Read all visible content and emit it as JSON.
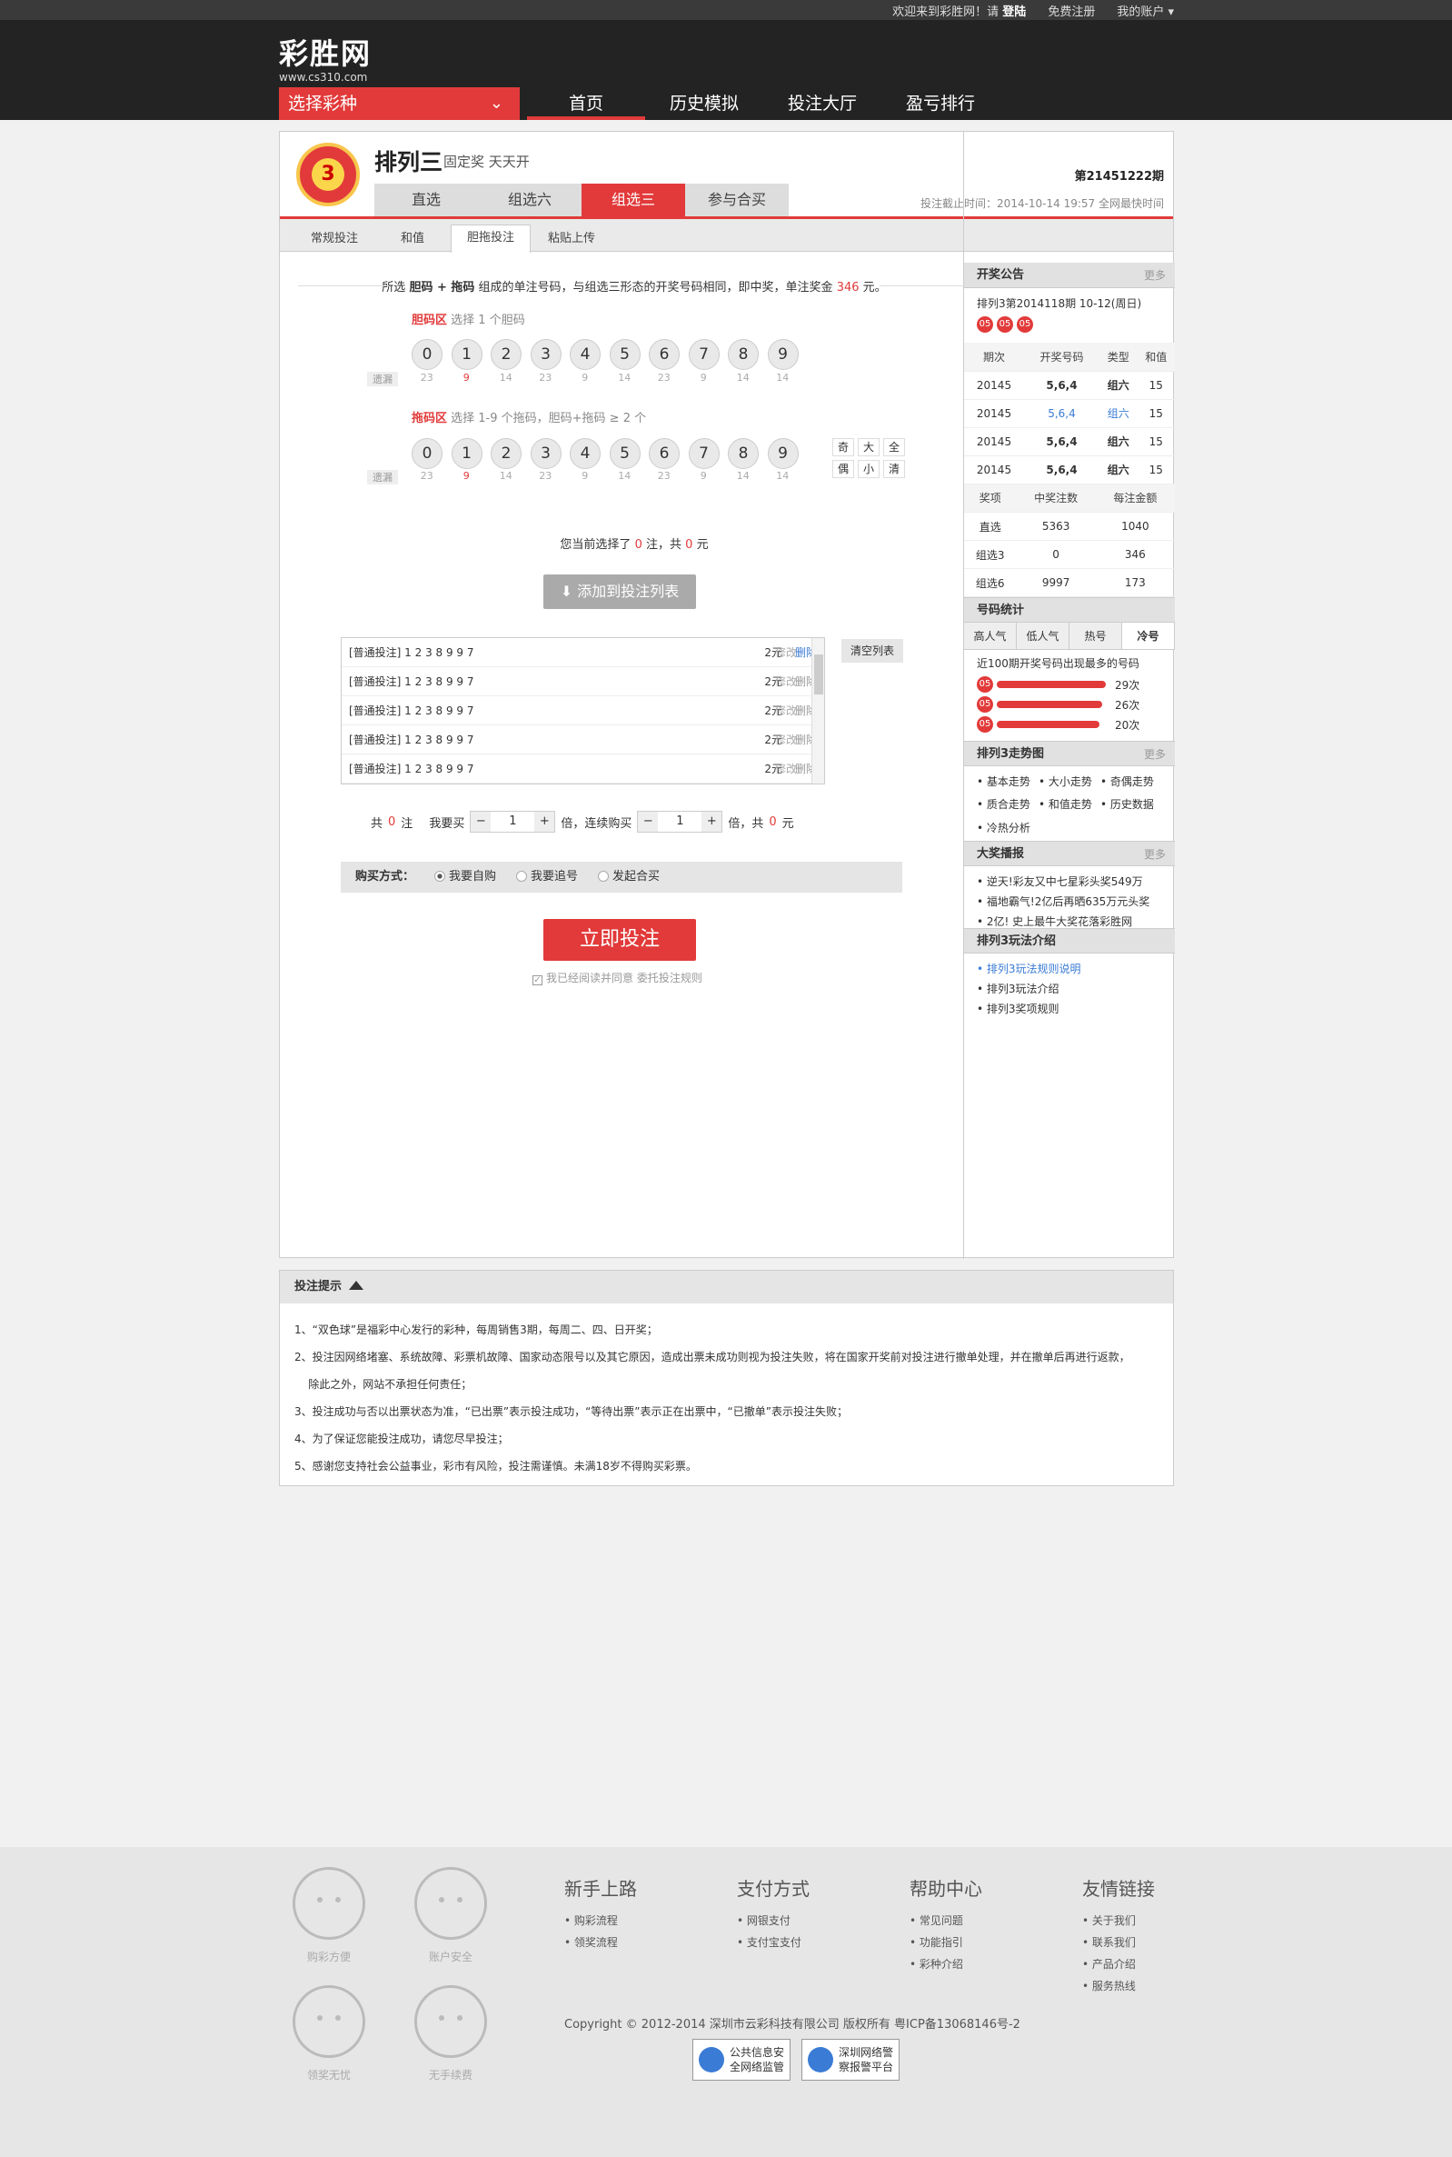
{
  "topbar": {
    "welcome": "欢迎来到彩胜网！请",
    "login": "登陆",
    "register": "免费注册",
    "account": "我的账户 ▾"
  },
  "logo": {
    "name": "彩胜网",
    "url": "www.cs310.com"
  },
  "select_lottery": "选择彩种",
  "nav": [
    "首页",
    "历史模拟",
    "投注大厅",
    "盈亏排行"
  ],
  "product": {
    "badge_text": "3",
    "name": "排列三",
    "sub": "固定奖 天天开",
    "issue": "第21451222期",
    "deadline": "投注截止时间：2014-10-14 19:57 全网最快时间",
    "tabs": [
      "直选",
      "组选六",
      "组选三",
      "参与合买"
    ],
    "subtabs": [
      "常规投注",
      "和值",
      "胆拖投注",
      "粘贴上传"
    ]
  },
  "rule": {
    "pre": "所选",
    "bold": "胆码 + 拖码",
    "mid": "组成的单注号码，与组选三形态的开奖号码相同，即中奖，单注奖金",
    "prize": "346",
    "post": "元。"
  },
  "zones": {
    "dan_label": "胆码区",
    "dan_hint": "选择 1 个胆码",
    "tuo_label": "拖码区",
    "tuo_hint": "选择 1-9 个拖码，胆码+拖码 ≥ 2 个",
    "miss_label": "遗漏",
    "balls": [
      "0",
      "1",
      "2",
      "3",
      "4",
      "5",
      "6",
      "7",
      "8",
      "9"
    ],
    "miss": [
      "23",
      "9",
      "14",
      "23",
      "9",
      "14",
      "23",
      "9",
      "14",
      "14"
    ],
    "quick": [
      "奇",
      "大",
      "全",
      "偶",
      "小",
      "清"
    ]
  },
  "summary": {
    "pre": "您当前选择了",
    "count": "0",
    "mid": "注，共",
    "amount": "0",
    "post": "元"
  },
  "add_button": "⬇ 添加到投注列表",
  "betlist": [
    {
      "label": "[普通投注]  1 2 3 8 9 9 7",
      "amount": "2元",
      "edit": "修改",
      "del": "删除"
    },
    {
      "label": "[普通投注]  1 2 3 8 9 9 7",
      "amount": "2元",
      "edit": "修改",
      "del": "删除"
    },
    {
      "label": "[普通投注]  1 2 3 8 9 9 7",
      "amount": "2元",
      "edit": "修改",
      "del": "删除"
    },
    {
      "label": "[普通投注]  1 2 3 8 9 9 7",
      "amount": "2元",
      "edit": "修改",
      "del": "删除"
    },
    {
      "label": "[普通投注]  1 2 3 8 9 9 7",
      "amount": "2元",
      "edit": "修改",
      "del": "删除"
    }
  ],
  "clear_button": "清空列表",
  "mult": {
    "total_pre": "共",
    "total_count": "0",
    "total_unit": "注",
    "buy_label": "我要买",
    "buy_value": "1",
    "times_label": "倍，连续购买",
    "cont_value": "1",
    "cont_unit": "倍，共",
    "amount": "0",
    "amount_unit": "元",
    "minus": "−",
    "plus": "+"
  },
  "buyway": {
    "label": "购买方式：",
    "options": [
      "我要自购",
      "我要追号",
      "发起合买"
    ]
  },
  "bet_now": "立即投注",
  "agree": "我已经阅读并同意 委托投注规则",
  "side": {
    "notice_title": "开奖公告",
    "more": "更多",
    "notice_draw": "排列3第2014118期 10-12(周日)",
    "notice_balls": [
      "05",
      "05",
      "05"
    ],
    "hist_head": [
      "期次",
      "开奖号码",
      "类型",
      "和值"
    ],
    "hist": [
      [
        "20145",
        "5,6,4",
        "组六",
        "15"
      ],
      [
        "20145",
        "5,6,4",
        "组六",
        "15"
      ],
      [
        "20145",
        "5,6,4",
        "组六",
        "15"
      ],
      [
        "20145",
        "5,6,4",
        "组六",
        "15"
      ]
    ],
    "prize_head": [
      "奖项",
      "中奖注数",
      "每注金额"
    ],
    "prize": [
      [
        "直选",
        "5363",
        "1040"
      ],
      [
        "组选3",
        "0",
        "346"
      ],
      [
        "组选6",
        "9997",
        "173"
      ]
    ],
    "stat_title": "号码统计",
    "stat_tabs": [
      "高人气",
      "低人气",
      "热号",
      "冷号"
    ],
    "stat_desc": "近100期开奖号码出现最多的号码",
    "stat_rows": [
      {
        "ball": "05",
        "text": "29次",
        "pct": 100
      },
      {
        "ball": "05",
        "text": "26次",
        "pct": 97
      },
      {
        "ball": "05",
        "text": "20次",
        "pct": 94
      }
    ],
    "trend_title": "排列3走势图",
    "trend_links": [
      "基本走势",
      "大小走势",
      "奇偶走势",
      "质合走势",
      "和值走势",
      "历史数据",
      "冷热分析"
    ],
    "award_title": "大奖播报",
    "awards": [
      "逆天!彩友又中七星彩头奖549万",
      "福地霸气!2亿后再晒635万元头奖",
      "2亿! 史上最牛大奖花落彩胜网"
    ],
    "intro_title": "排列3玩法介绍",
    "intro": [
      "排列3玩法规则说明",
      "排列3玩法介绍",
      "排列3奖项规则"
    ]
  },
  "tips": {
    "title": "投注提示",
    "lines": [
      "1、“双色球”是福彩中心发行的彩种，每周销售3期，每周二、四、日开奖；",
      "2、投注因网络堵塞、系统故障、彩票机故障、国家动态限号以及其它原因，造成出票未成功则视为投注失败，将在国家开奖前对投注进行撤单处理，并在撤单后再进行返款，",
      "    除此之外，网站不承担任何责任；",
      "3、投注成功与否以出票状态为准，“已出票”表示投注成功，“等待出票”表示正在出票中，“已撤单”表示投注失败；",
      "4、为了保证您能投注成功，请您尽早投注；",
      "5、感谢您支持社会公益事业，彩市有风险，投注需谨慎。未满18岁不得购买彩票。"
    ]
  },
  "footer": {
    "icons": [
      "购彩方便",
      "账户安全",
      "领奖无忧",
      "无手续费"
    ],
    "cols": [
      {
        "title": "新手上路",
        "links": [
          "• 购彩流程",
          "• 领奖流程"
        ]
      },
      {
        "title": "支付方式",
        "links": [
          "• 网银支付",
          "• 支付宝支付"
        ]
      },
      {
        "title": "帮助中心",
        "links": [
          "• 常见问题",
          "• 功能指引",
          "• 彩种介绍"
        ]
      },
      {
        "title": "友情链接",
        "links": [
          "• 关于我们",
          "• 联系我们",
          "• 产品介绍",
          "• 服务热线"
        ]
      }
    ],
    "copyright": "Copyright © 2012-2014 深圳市云彩科技有限公司 版权所有 粤ICP备13068146号-2",
    "seals": [
      "公共信息安全网络监管",
      "深圳网络警察报警平台"
    ]
  }
}
